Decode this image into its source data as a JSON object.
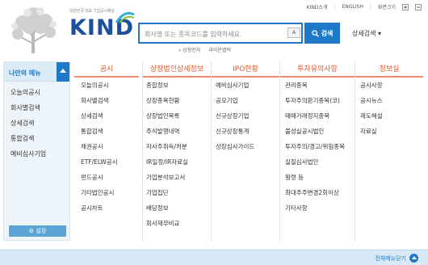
{
  "header": {
    "logo_tagline": "대한민국 대표 기업공시채널",
    "logo_word": "KIND",
    "top_links": [
      "KIND소개",
      "ENGLISH",
      "화면크기"
    ],
    "search_placeholder": "회사명 또는 종목코드를 입력하세요.",
    "search_option": "A",
    "search_button": "검색",
    "advanced_search": "상세검색 ▾",
    "sub_links": [
      "상장전자",
      "라이온랩턱"
    ]
  },
  "sidebar": {
    "title": "나만의 메뉴",
    "items": [
      "오늘의공시",
      "회사별검색",
      "상세검색",
      "통합검색",
      "예비심사기업"
    ],
    "settings": "설정"
  },
  "columns": [
    {
      "title": "공시",
      "items": [
        "오늘의공시",
        "회사별검색",
        "상세검색",
        "통합검색",
        "채권공시",
        "ETF/ELW공시",
        "펀드공시",
        "기타법인공시",
        "공시차트"
      ]
    },
    {
      "title": "상장법인상세정보",
      "items": [
        "종합정보",
        "상장종목현황",
        "상장법인목록",
        "주식발행내역",
        "자사주취득/처분",
        "IR일정/IR자료실",
        "기업분석보고서",
        "기업집단",
        "배당정보",
        "회사재무비교"
      ]
    },
    {
      "title": "IPO현황",
      "items": [
        "예비심사기업",
        "공모기업",
        "신규상장기업",
        "신규상장통계",
        "상장심사가이드"
      ]
    },
    {
      "title": "투자유의사항",
      "items": [
        "관리종목",
        "투자주의환기종목(코)",
        "매매거래정지종목",
        "불성실공시법인",
        "투자주의/경고/위험종목",
        "실질심사법인",
        "횡령 등",
        "최대주주변경2회이상",
        "기타사항"
      ]
    },
    {
      "title": "정보실",
      "items": [
        "공시사항",
        "공시뉴스",
        "제도해설",
        "자료실"
      ]
    }
  ],
  "footer": {
    "close_all": "전체메뉴닫기"
  },
  "colors": {
    "accent_blue": "#1f79c8",
    "heading_orange": "#e9572d"
  }
}
